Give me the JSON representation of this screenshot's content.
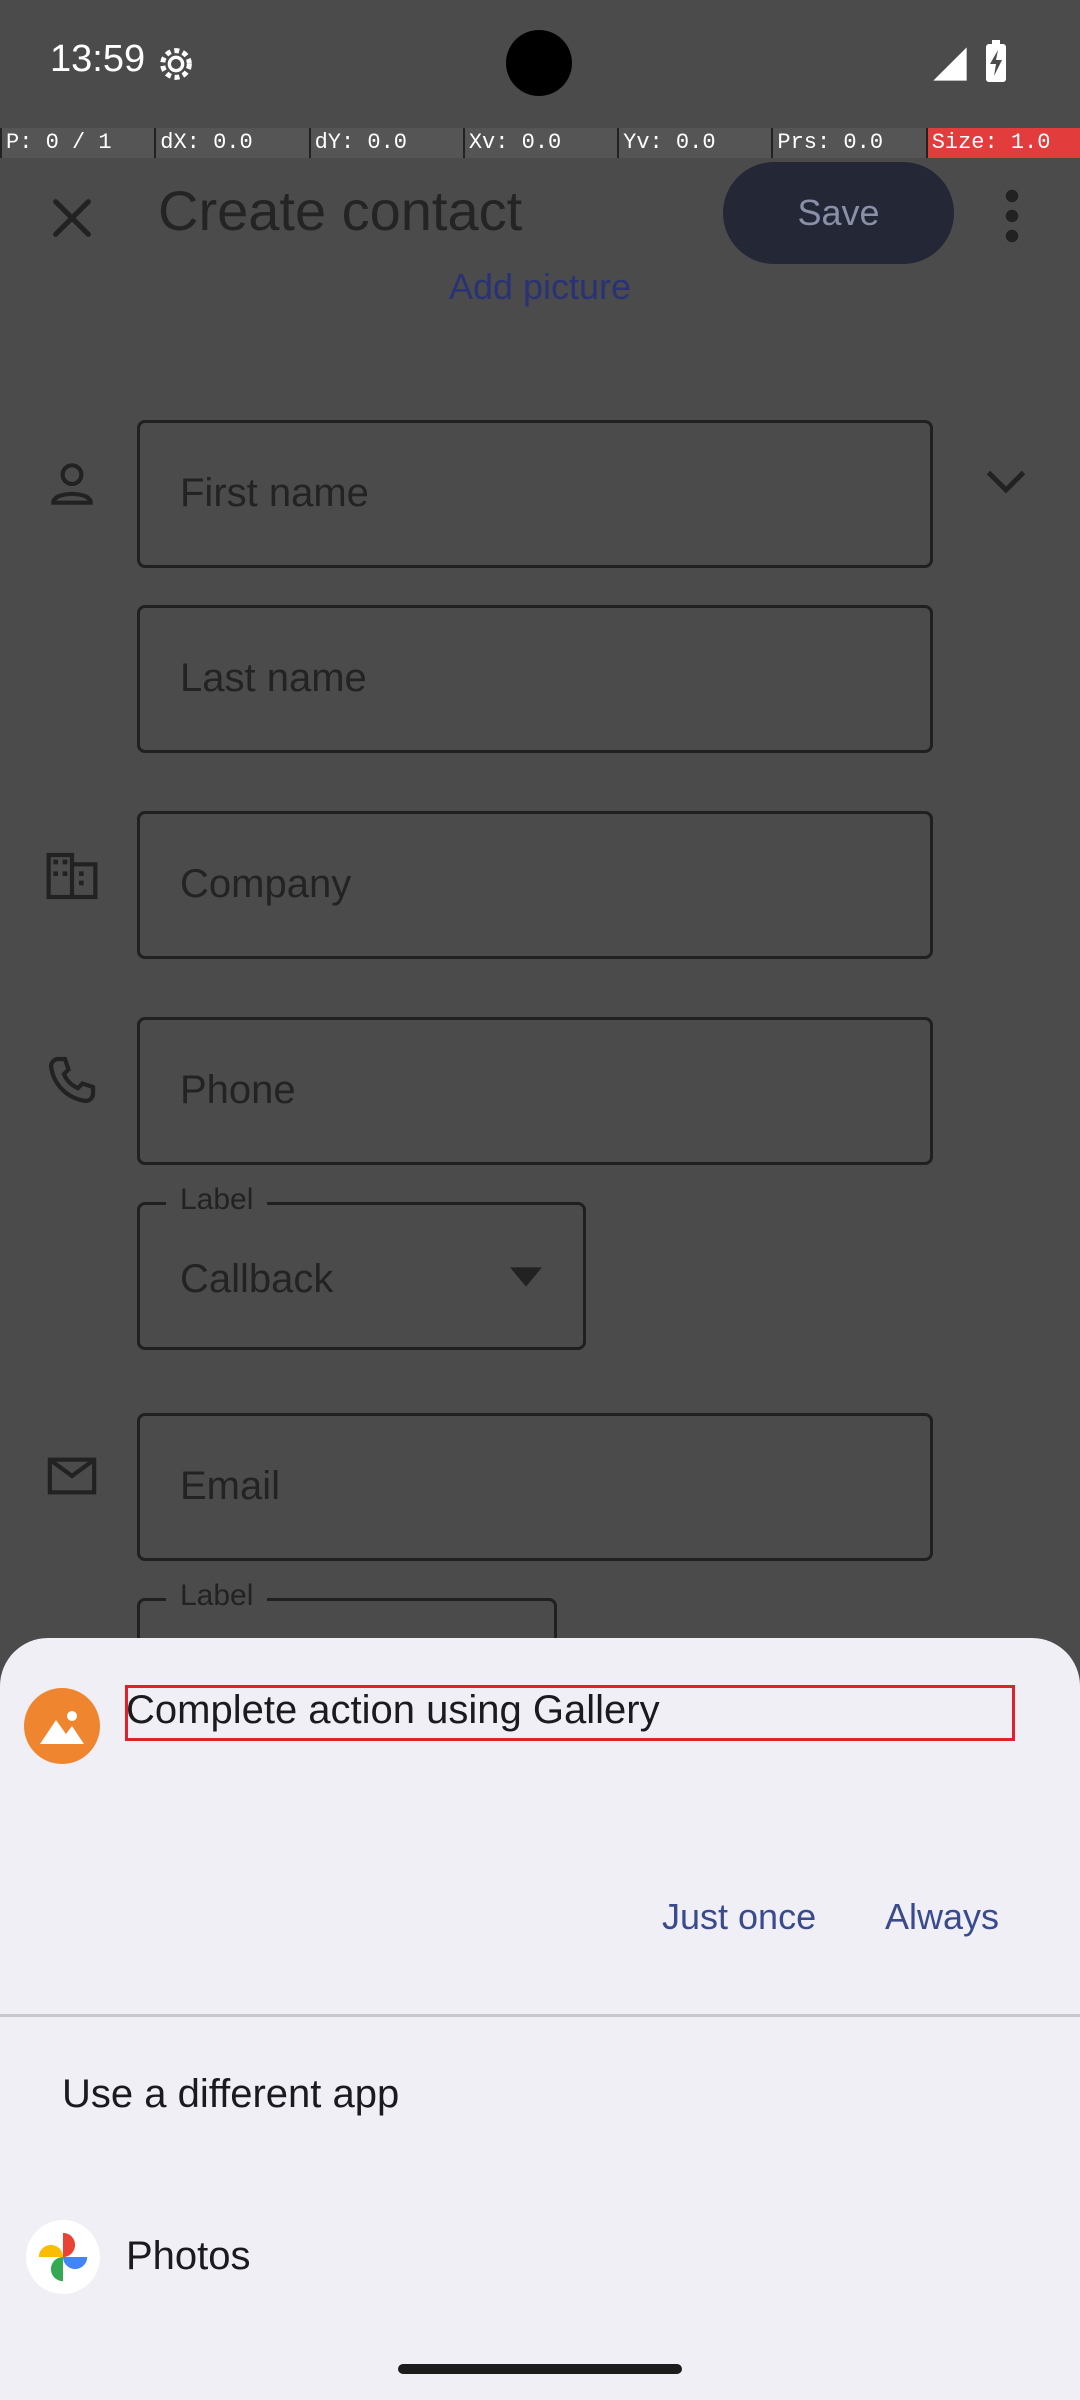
{
  "status_bar": {
    "time": "13:59"
  },
  "debug_overlay": {
    "items": [
      "P: 0 / 1",
      "dX: 0.0",
      "dY: 0.0",
      "Xv: 0.0",
      "Yv: 0.0",
      "Prs: 0.0",
      "Size: 1.0"
    ]
  },
  "toolbar": {
    "title": "Create contact",
    "save_label": "Save",
    "add_picture_label": "Add picture"
  },
  "form": {
    "first_name_placeholder": "First name",
    "last_name_placeholder": "Last name",
    "company_placeholder": "Company",
    "phone_placeholder": "Phone",
    "phone_label_legend": "Label",
    "phone_label_value": "Callback",
    "email_placeholder": "Email",
    "email_label_legend": "Label"
  },
  "sheet": {
    "title": "Complete action using Gallery",
    "just_once_label": "Just once",
    "always_label": "Always",
    "alternative_label": "Use a different app",
    "alternative_app_name": "Photos"
  },
  "icons": {
    "gallery_app": "gallery-icon",
    "photos_app": "photos-pinwheel-icon"
  },
  "colors": {
    "accent": "#3a4a8f",
    "focus_outline": "#e0202a",
    "gallery_icon": "#f0852f"
  }
}
